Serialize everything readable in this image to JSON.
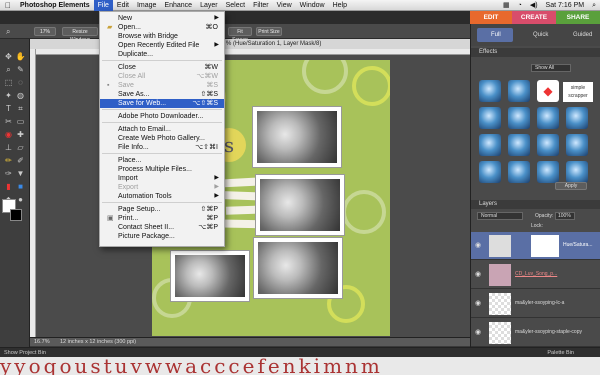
{
  "menubar": {
    "apple": "",
    "app_name": "Photoshop Elements",
    "menus": [
      "File",
      "Edit",
      "Image",
      "Enhance",
      "Layer",
      "Select",
      "Filter",
      "View",
      "Window",
      "Help"
    ],
    "clock": "Sat 7:16 PM"
  },
  "modes": {
    "edit": "EDIT",
    "create": "CREATE",
    "share": "SHARE"
  },
  "edit_views": {
    "full": "Full",
    "quick": "Quick",
    "guided": "Guided"
  },
  "options": {
    "zoom": "17%",
    "resize": "Resize Windows",
    "fit_screen": "Fit Screen",
    "print_size": "Print Size"
  },
  "document_tab": "% (Hue/Saturation 1, Layer Mask/8)",
  "file_menu": {
    "items": [
      {
        "label": "New",
        "shortcut": "",
        "submenu": true,
        "disabled": false
      },
      {
        "label": "Open...",
        "shortcut": "⌘O",
        "submenu": false,
        "disabled": false
      },
      {
        "label": "Browse with Bridge",
        "shortcut": "",
        "submenu": false,
        "disabled": false
      },
      {
        "label": "Open Recently Edited File",
        "shortcut": "",
        "submenu": true,
        "disabled": false
      },
      {
        "label": "Duplicate...",
        "shortcut": "",
        "submenu": false,
        "disabled": false
      },
      {
        "label": "Close",
        "shortcut": "⌘W",
        "submenu": false,
        "disabled": false
      },
      {
        "label": "Close All",
        "shortcut": "⌥⌘W",
        "submenu": false,
        "disabled": true
      },
      {
        "label": "Save",
        "shortcut": "⌘S",
        "submenu": false,
        "disabled": true
      },
      {
        "label": "Save As...",
        "shortcut": "⇧⌘S",
        "submenu": false,
        "disabled": false
      },
      {
        "label": "Save for Web...",
        "shortcut": "⌥⇧⌘S",
        "submenu": false,
        "disabled": false,
        "highlighted": true
      },
      {
        "label": "Adobe Photo Downloader...",
        "shortcut": "",
        "submenu": false,
        "disabled": false
      },
      {
        "label": "Attach to Email...",
        "shortcut": "",
        "submenu": false,
        "disabled": false
      },
      {
        "label": "Create Web Photo Gallery...",
        "shortcut": "",
        "submenu": false,
        "disabled": false
      },
      {
        "label": "File Info...",
        "shortcut": "⌥⇧⌘I",
        "submenu": false,
        "disabled": false
      },
      {
        "label": "Place...",
        "shortcut": "",
        "submenu": false,
        "disabled": false
      },
      {
        "label": "Process Multiple Files...",
        "shortcut": "",
        "submenu": false,
        "disabled": false
      },
      {
        "label": "Import",
        "shortcut": "",
        "submenu": true,
        "disabled": false
      },
      {
        "label": "Export",
        "shortcut": "",
        "submenu": true,
        "disabled": true
      },
      {
        "label": "Automation Tools",
        "shortcut": "",
        "submenu": true,
        "disabled": false
      },
      {
        "label": "Page Setup...",
        "shortcut": "⇧⌘P",
        "submenu": false,
        "disabled": false
      },
      {
        "label": "Print...",
        "shortcut": "⌘P",
        "submenu": false,
        "disabled": false
      },
      {
        "label": "Contact Sheet II...",
        "shortcut": "⌥⌘P",
        "submenu": false,
        "disabled": false
      },
      {
        "label": "Picture Package...",
        "shortcut": "",
        "submenu": false,
        "disabled": false
      }
    ]
  },
  "canvas": {
    "page_label": "s"
  },
  "status": {
    "zoom": "16.7%",
    "doc_size": "12 inches x 12 inches (300 ppi)"
  },
  "effects": {
    "title": "Effects",
    "show_all": "Show All",
    "simple_scrapper": "simple scrapper",
    "apply": "Apply"
  },
  "layers": {
    "title": "Layers",
    "blend": "Normal",
    "opacity_label": "Opacity:",
    "opacity_value": "100%",
    "lock_label": "Lock:",
    "items": [
      {
        "name": "Hue/Satura..."
      },
      {
        "name": "CD_Luv_Song_p..."
      },
      {
        "name": "ma&yler-ssoyping-lc-a"
      },
      {
        "name": "ma&yler-ssoyping-staple-copy"
      }
    ]
  },
  "bottom": {
    "project_bin": "Show Project Bin",
    "palette_bin": "Palette Bin"
  },
  "dock_text": "yyoqoustuvwwacccefenkimnm",
  "colors": {
    "edit": "#e8692d",
    "create": "#d84d6b",
    "share": "#5aa03c",
    "menu_highlight": "#2f5fc7"
  }
}
